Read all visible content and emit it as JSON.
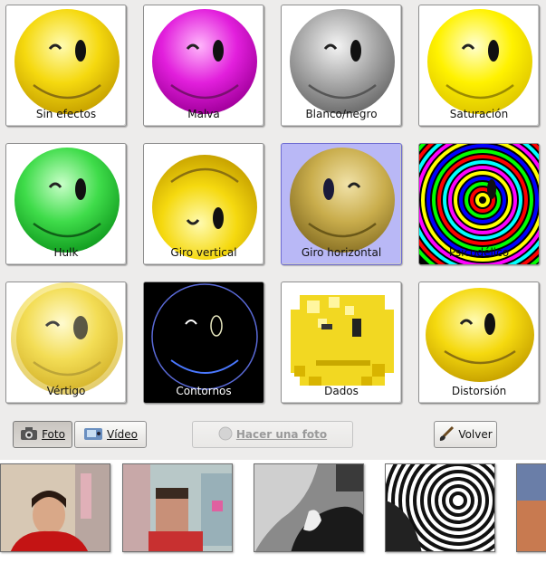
{
  "effects": [
    {
      "label": "Sin efectos"
    },
    {
      "label": "Malva"
    },
    {
      "label": "Blanco/negro"
    },
    {
      "label": "Saturación"
    },
    {
      "label": "Hulk"
    },
    {
      "label": "Giro vertical"
    },
    {
      "label": "Giro horizontal",
      "selected": true
    },
    {
      "label": "Psicodélico"
    },
    {
      "label": "Vértigo"
    },
    {
      "label": "Contornos"
    },
    {
      "label": "Dados"
    },
    {
      "label": "Distorsión"
    }
  ],
  "toolbar": {
    "photo_label": "Foto",
    "video_label": "Vídeo",
    "take_photo_label": "Hacer una foto",
    "back_label": "Volver"
  },
  "colors": {
    "selected_tile": "#b9b8f6",
    "yellow": "#f5d90f",
    "magenta": "#e21fdc",
    "gray": "#a9a9a9",
    "green": "#3fdc4a"
  },
  "thumbnails": [
    {
      "icon": "photo-normal"
    },
    {
      "icon": "photo-dice"
    },
    {
      "icon": "photo-bw"
    },
    {
      "icon": "photo-warp"
    },
    {
      "icon": "photo-partial"
    }
  ]
}
